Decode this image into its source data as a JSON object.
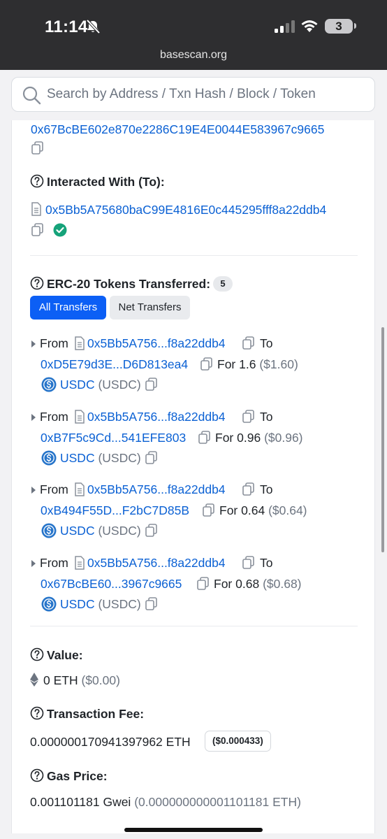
{
  "status_bar": {
    "time": "11:14",
    "battery": "3"
  },
  "browser": {
    "url": "basescan.org"
  },
  "search": {
    "placeholder": "Search by Address / Txn Hash / Block / Token / Domain Name"
  },
  "from_address": "0x67BcBE602e870e2286C19E4E0044E583967c9665",
  "interacted_with": {
    "label": "Interacted With (To):",
    "address": "0x5Bb5A75680baC99E4816E0c445295fff8a22ddb4"
  },
  "erc20": {
    "label": "ERC-20 Tokens Transferred:",
    "count": "5",
    "tabs": [
      "All Transfers",
      "Net Transfers"
    ],
    "transfers": [
      {
        "from_label": "From",
        "from": "0x5Bb5A756...f8a22ddb4",
        "to_label": "To",
        "to": "0xD5E79d3E...D6D813ea4",
        "for_label": "For",
        "amount": "1.6",
        "usd": "($1.60)",
        "token": "USDC",
        "symbol": "(USDC)"
      },
      {
        "from_label": "From",
        "from": "0x5Bb5A756...f8a22ddb4",
        "to_label": "To",
        "to": "0xB7F5c9Cd...541EFE803",
        "for_label": "For",
        "amount": "0.96",
        "usd": "($0.96)",
        "token": "USDC",
        "symbol": "(USDC)"
      },
      {
        "from_label": "From",
        "from": "0x5Bb5A756...f8a22ddb4",
        "to_label": "To",
        "to": "0xB494F55D...F2bC7D85B",
        "for_label": "For",
        "amount": "0.64",
        "usd": "($0.64)",
        "token": "USDC",
        "symbol": "(USDC)"
      },
      {
        "from_label": "From",
        "from": "0x5Bb5A756...f8a22ddb4",
        "to_label": "To",
        "to": "0x67BcBE60...3967c9665",
        "for_label": "For",
        "amount": "0.68",
        "usd": "($0.68)",
        "token": "USDC",
        "symbol": "(USDC)"
      }
    ]
  },
  "value": {
    "label": "Value:",
    "amount": "0 ETH",
    "usd": "($0.00)"
  },
  "fee": {
    "label": "Transaction Fee:",
    "amount": "0.000000170941397962 ETH",
    "usd": "($0.000433)"
  },
  "gas": {
    "label": "Gas Price:",
    "gwei": "0.001101181 Gwei",
    "eth": "(0.000000000001101181 ETH)"
  },
  "colors": {
    "accent": "#0c5ff5",
    "link": "#0b61d4",
    "verified": "#16a37a",
    "usdc": "#2775ca"
  }
}
